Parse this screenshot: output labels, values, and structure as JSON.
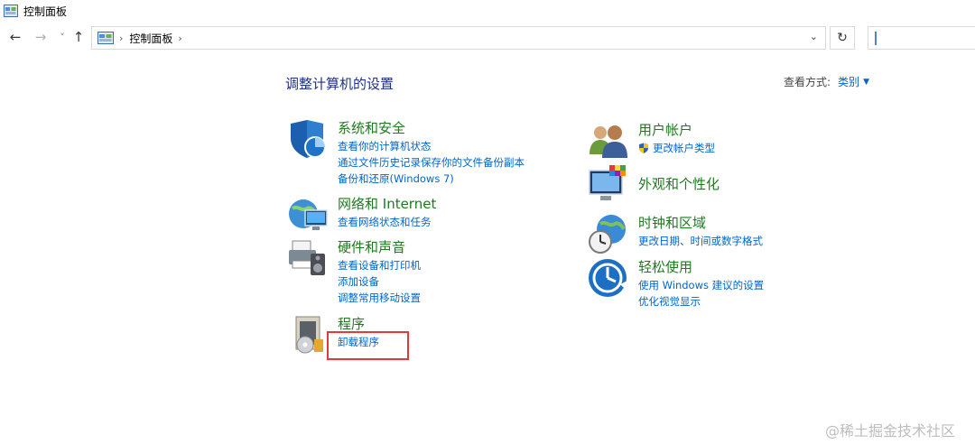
{
  "window": {
    "title": "控制面板"
  },
  "nav": {
    "back": "←",
    "forward": "→",
    "recent": "˅",
    "up": "↑",
    "sep": "›",
    "breadcrumb": "控制面板",
    "dropdown": "⌄",
    "refresh": "↻"
  },
  "heading": "调整计算机的设置",
  "view_by": {
    "label": "查看方式:",
    "value": "类别",
    "arrow": "▼"
  },
  "categories": {
    "system": {
      "title": "系统和安全",
      "links": [
        "查看你的计算机状态",
        "通过文件历史记录保存你的文件备份副本",
        "备份和还原(Windows 7)"
      ]
    },
    "network": {
      "title": "网络和 Internet",
      "links": [
        "查看网络状态和任务"
      ]
    },
    "hardware": {
      "title": "硬件和声音",
      "links": [
        "查看设备和打印机",
        "添加设备",
        "调整常用移动设置"
      ]
    },
    "programs": {
      "title": "程序",
      "links": [
        "卸载程序"
      ]
    },
    "accounts": {
      "title": "用户帐户",
      "links": [
        "更改帐户类型"
      ]
    },
    "appearance": {
      "title": "外观和个性化",
      "links": []
    },
    "clock": {
      "title": "时钟和区域",
      "links": [
        "更改日期、时间或数字格式"
      ]
    },
    "ease": {
      "title": "轻松使用",
      "links": [
        "使用 Windows 建议的设置",
        "优化视觉显示"
      ]
    }
  },
  "watermark": "@稀土掘金技术社区",
  "colors": {
    "link": "#0066cc",
    "category_title": "#1f7a1f",
    "heading": "#1e3287",
    "highlight": "#e23a3a"
  }
}
